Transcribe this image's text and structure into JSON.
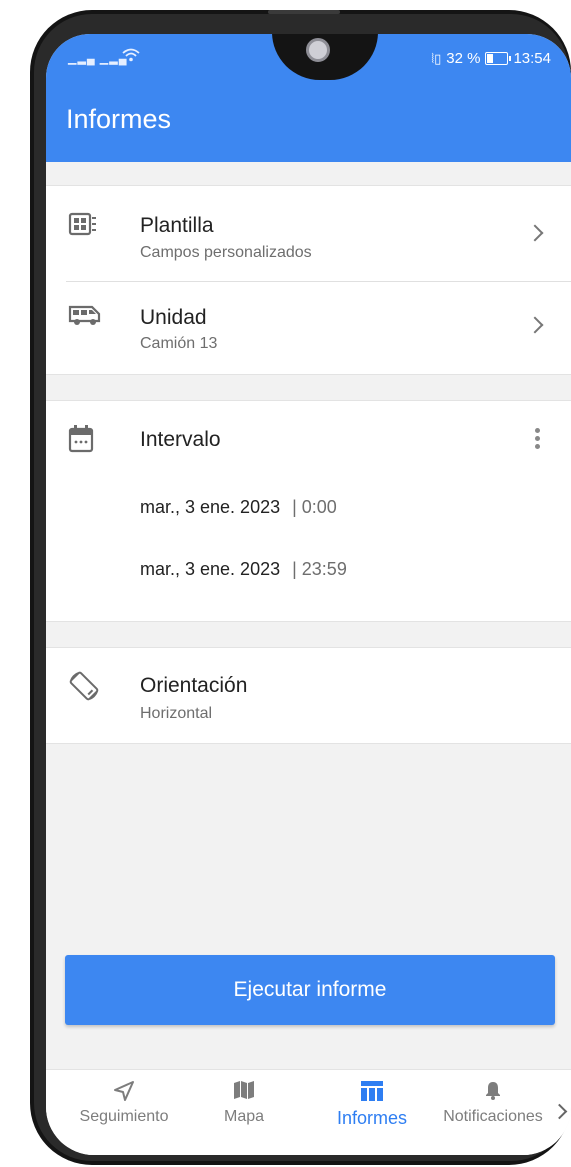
{
  "status_bar": {
    "battery_text": "32 %",
    "time": "13:54"
  },
  "appbar": {
    "title": "Informes"
  },
  "template": {
    "title": "Plantilla",
    "subtitle": "Campos personalizados"
  },
  "unit": {
    "title": "Unidad",
    "subtitle": "Camión 13"
  },
  "interval": {
    "title": "Intervalo",
    "start": {
      "date": "mar., 3 ene. 2023",
      "time": "| 0:00"
    },
    "end": {
      "date": "mar., 3 ene. 2023",
      "time": "| 23:59"
    }
  },
  "orientation": {
    "title": "Orientación",
    "subtitle": "Horizontal"
  },
  "run_button": "Ejecutar informe",
  "nav": {
    "items": [
      {
        "label": "Seguimiento",
        "icon": "navigation-arrow-icon"
      },
      {
        "label": "Mapa",
        "icon": "map-icon"
      },
      {
        "label": "Informes",
        "icon": "table-icon",
        "active": true
      },
      {
        "label": "Notificaciones",
        "icon": "bell-icon"
      }
    ]
  },
  "colors": {
    "primary": "#3d87f1",
    "active_nav": "#2e7ef2"
  }
}
